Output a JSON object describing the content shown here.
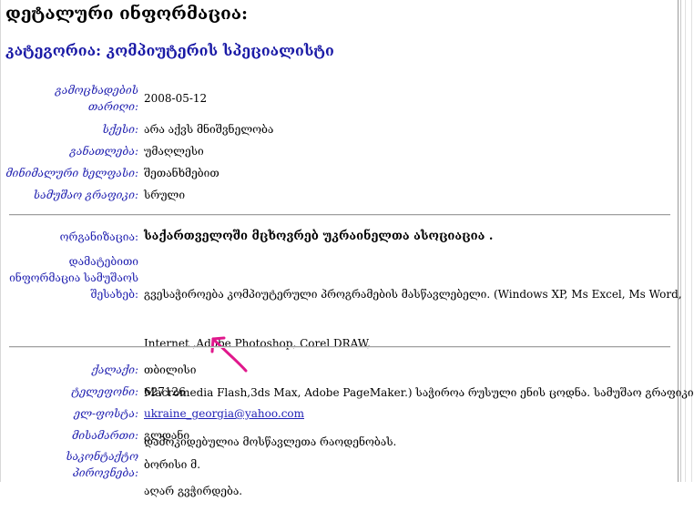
{
  "page": {
    "heading": "დეტალური ინფორმაცია:",
    "category": "კატეგორია: კომპიუტერის სპეციალისტი"
  },
  "details": [
    {
      "label_lines": [
        "გამოცხადების",
        "თარიღი:"
      ],
      "value_lines": [
        "2008-05-12"
      ]
    },
    {
      "label_lines": [
        "სქესი:"
      ],
      "value_lines": [
        "არა აქვს მნიშვნელობა"
      ]
    },
    {
      "label_lines": [
        "განათლება:"
      ],
      "value_lines": [
        "უმაღლესი"
      ]
    },
    {
      "label_lines": [
        "მინიმალური ხელფასი:"
      ],
      "value_lines": [
        "შეთანხმებით"
      ]
    },
    {
      "label_lines": [
        "სამუშაო გრაფიკი:"
      ],
      "value_lines": [
        "სრული"
      ]
    }
  ],
  "organization": {
    "label": "ორგანიზაცია:",
    "name": "საქართველოში მცხოვრებ უკრაინელთა ასოციაცია ."
  },
  "more_info": {
    "label_lines": [
      "დამატებითი",
      "ინფორმაცია სამუშაოს",
      "შესახებ:"
    ],
    "text_lines": [
      "გვესაჭიროება კომპიუტერული პროგრამების მასწავლებელი. (Windows XP, Ms Excel, Ms Word,",
      "Internet ,Adobe Photoshop, Corel DRAW,",
      "Macromedia Flash,3ds Max, Adobe PageMaker.) საჭიროა რუსული ენის ცოდნა. სამუშაო გრაფიკი",
      "დამოკიდებულია მოსწავლეთა რაოდენობას.",
      "აღარ გვჭირდება."
    ]
  },
  "contacts": [
    {
      "label_lines": [
        "ქალაქი:"
      ],
      "value_lines": [
        "თბილისი"
      ],
      "link": false
    },
    {
      "label_lines": [
        "ტელეფონი:"
      ],
      "value_lines": [
        "627126"
      ],
      "link": false
    },
    {
      "label_lines": [
        "ელ-ფოსტა:"
      ],
      "value_lines": [
        "ukraine_georgia@yahoo.com"
      ],
      "link": true
    },
    {
      "label_lines": [
        "მისამართი:"
      ],
      "value_lines": [
        "გლდანი"
      ],
      "link": false
    },
    {
      "label_lines": [
        "საკონტაქტო",
        "პიროვნება:"
      ],
      "value_lines": [
        "ბორისი მ."
      ],
      "link": false
    }
  ],
  "annotation": {
    "arrow_color": "#e0188c",
    "arrow_icon": "hand-drawn-arrow-icon"
  },
  "colors": {
    "label": "#2020b0",
    "heading_link": "#1a1aa6",
    "separator": "#9f9f9f"
  }
}
